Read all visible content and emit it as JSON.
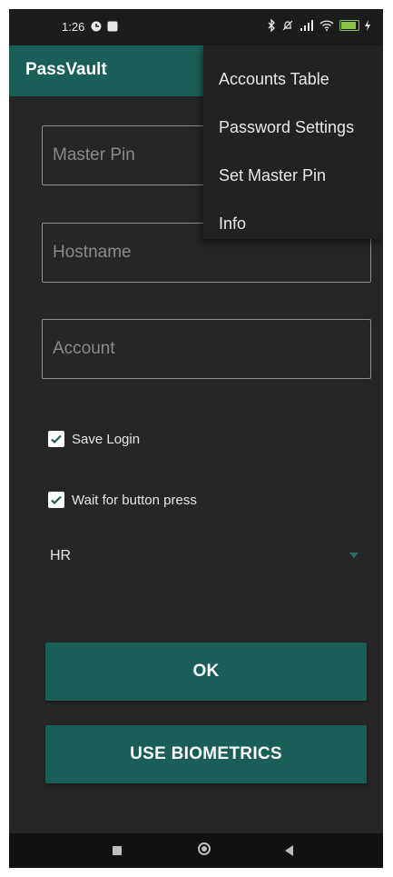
{
  "status_bar": {
    "time": "1:26",
    "battery": "89"
  },
  "app_bar": {
    "title": "PassVault"
  },
  "form": {
    "master_pin": {
      "placeholder": "Master Pin",
      "value": ""
    },
    "hostname": {
      "placeholder": "Hostname",
      "value": ""
    },
    "account": {
      "placeholder": "Account",
      "value": ""
    },
    "save_login": {
      "label": "Save Login",
      "checked": true
    },
    "wait_button": {
      "label": "Wait for button press",
      "checked": true
    },
    "layout_select": {
      "value": "HR"
    }
  },
  "buttons": {
    "ok": "OK",
    "biometrics": "USE BIOMETRICS"
  },
  "menu": {
    "items": [
      "Accounts Table",
      "Password Settings",
      "Set Master Pin",
      "Info"
    ]
  },
  "colors": {
    "primary": "#1a5f57",
    "background": "#262626",
    "menu": "#222222"
  }
}
